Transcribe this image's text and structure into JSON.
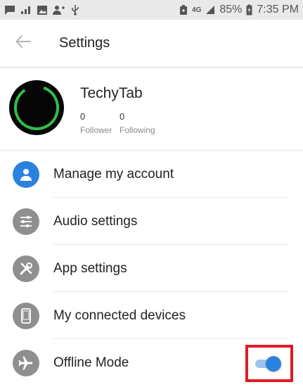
{
  "status_bar": {
    "network": "4G",
    "battery_percent": "85%",
    "time": "7:35 PM"
  },
  "app_bar": {
    "title": "Settings"
  },
  "profile": {
    "name": "TechyTab",
    "follower_count": "0",
    "follower_label": "Follower",
    "following_count": "0",
    "following_label": "Following"
  },
  "menu": {
    "items": [
      {
        "label": "Manage my account",
        "icon": "account-icon"
      },
      {
        "label": "Audio settings",
        "icon": "sliders-icon"
      },
      {
        "label": "App settings",
        "icon": "tools-icon"
      },
      {
        "label": "My connected devices",
        "icon": "phone-icon"
      },
      {
        "label": "Offline Mode",
        "icon": "airplane-icon"
      }
    ],
    "offline_mode_enabled": true
  },
  "colors": {
    "accent": "#2a82e0",
    "icon_grey": "#8f8f8f",
    "highlight": "#e01b24",
    "avatar_ring": "#2fbf4a"
  }
}
